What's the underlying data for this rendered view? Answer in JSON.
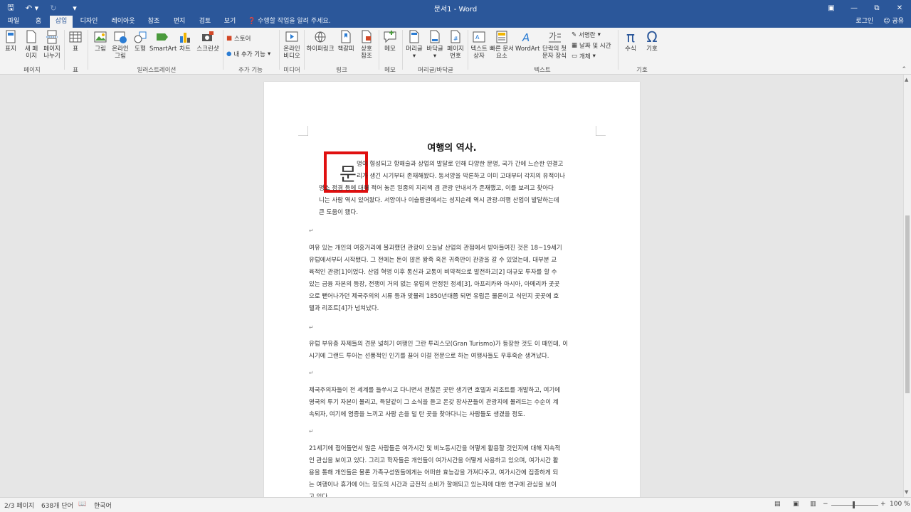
{
  "window": {
    "title": "문서1 - Word",
    "qat": [
      "save-icon",
      "undo-icon",
      "redo-icon",
      "customize-icon"
    ],
    "controls": [
      "restore-ribbon-icon",
      "minimize-icon",
      "maximize-icon",
      "close-icon"
    ]
  },
  "tabs": [
    "파일",
    "홈",
    "삽입",
    "디자인",
    "레이아웃",
    "참조",
    "편지",
    "검토",
    "보기"
  ],
  "active_tab": "삽입",
  "tell_me": "수행할 작업을 알려 주세요.",
  "account": {
    "login": "로그인",
    "share": "공유"
  },
  "ribbon": {
    "pages": {
      "cover": "표지",
      "blank1": "새 페",
      "blank2": "이지",
      "break1": "페이지",
      "break2": "나누기",
      "group": "페이지"
    },
    "table": {
      "label": "표",
      "group": "표"
    },
    "illustrations": {
      "picture": "그림",
      "online1": "온라인",
      "online2": "그림",
      "shapes": "도형",
      "smartart": "SmartArt",
      "chart": "차트",
      "screenshot": "스크린샷",
      "group": "일러스트레이션"
    },
    "addins": {
      "store": "스토어",
      "my": "내 추가 기능",
      "group": "추가 기능"
    },
    "media": {
      "online1": "온라인",
      "online2": "비디오",
      "group": "미디어"
    },
    "links": {
      "hyperlink": "하이퍼링크",
      "bookmark": "책갈피",
      "cross1": "상호",
      "cross2": "참조",
      "group": "링크"
    },
    "comments": {
      "comment": "메모",
      "group": "메모"
    },
    "header_footer": {
      "header": "머리글",
      "footer": "바닥글",
      "pagenum1": "페이지",
      "pagenum2": "번호",
      "group": "머리글/바닥글"
    },
    "text": {
      "textbox1": "텍스트",
      "textbox2": "상자",
      "quick1": "빠른 문서",
      "quick2": "요소",
      "wordart": "WordArt",
      "dropcap1": "단락의 첫",
      "dropcap2": "문자 장식",
      "signature": "서명란",
      "datetime": "날짜 및 시간",
      "object": "개체",
      "group": "텍스트"
    },
    "symbols": {
      "equation": "수식",
      "symbol": "기호",
      "group": "기호"
    }
  },
  "document": {
    "title": "여행의 역사.",
    "dropcap_char": "문",
    "p1": [
      "명이 형성되고 항해술과 상업의 발달로 인해 다양한 문명, 국가 간에 느슨한 연결고",
      "리가 생긴 시기부터 존재해왔다. 동서양을 막론하고 이미 고대부터 각지의 유적이나",
      "명소 정경 등에 대해 적어 놓은 일종의 지리책 겸 관광 안내서가 존재했고, 이를 보려고 찾아다",
      "니는 사람 역시 있어왔다. 서양이나 이슬람권에서는 성지순례 역시 관광-여행 산업이 발달하는데",
      "큰 도움이 됐다."
    ],
    "p2": [
      "여유 있는 개인의 여흥거리에 불과했던 관광이 오늘날 산업의 관점에서 받아들여진 것은 18~19세기",
      "유럽에서부터 시작됐다. 그 전에는 돈이 많은 왕족 혹은 귀족만이 관광을 갈 수 있었는데, 대부분 교",
      "육적인 관광[1]이었다. 산업 혁명 이후 통신과 교통이 비약적으로 발전하고[2] 대규모 투자를 할 수",
      "있는 금융 자본의 등장, 전쟁이 거의 없는 유럽의 안정된 정세[3], 아프리카와 아시아, 아메리카 곳곳",
      "으로 뻗어나가던 제국주의의 시류 등과 맞물려 1850년대쯤 되면 유럽은 물론이고 식민지 곳곳에 호",
      "텔과 리조트[4]가 넘쳐났다."
    ],
    "p3": [
      "유럽 부유층 자제들의 견문 넓히기 여행인 그란 투리스모(Gran Turismo)가 등장한 것도 이 때인데, 이",
      "시기에 그랜드 투어는 선풍적인 인기를 끌어 이걸 전문으로 하는 여행사들도 우후죽순 생겨났다."
    ],
    "p4": [
      "제국주의자들이 전 세계를 들쑤시고 다니면서 괜찮은 곳만 생기면 호텔과 리조트를 개발하고, 여기에",
      "영국의 투기 자본이 몰리고, 득달같이 그 소식을 듣고 온갖 장사꾼들이 관광지에 몰려드는 수순이 계",
      "속되자, 여기에 염증을 느끼고 사람 손을 덜 탄 곳을 찾아다니는 사람들도 생겼을 정도."
    ],
    "p5": [
      "21세기에 접어들면서 많은 사람들은 여가시간 및 비노동시간을 어떻게 활용할 것인지에 대해 지속적",
      "인 관심을 보이고 있다. 그리고 학자들은 개인들이 여가시간을 어떻게 사용하고 있으며, 여가시간 활",
      "용을 통해 개인들은 물론 가족구성원들에게는 어떠한 효능감을 가져다주고, 여가시간에 집중하게 되",
      "는 여행이나 휴가에 어느 정도의 시간과 금전적 소비가 할애되고 있는지에 대한 연구에 관심을 보이",
      "고 있다."
    ]
  },
  "status": {
    "page": "2/3 페이지",
    "words": "638개 단어",
    "language": "한국어",
    "zoom": "100 %"
  }
}
